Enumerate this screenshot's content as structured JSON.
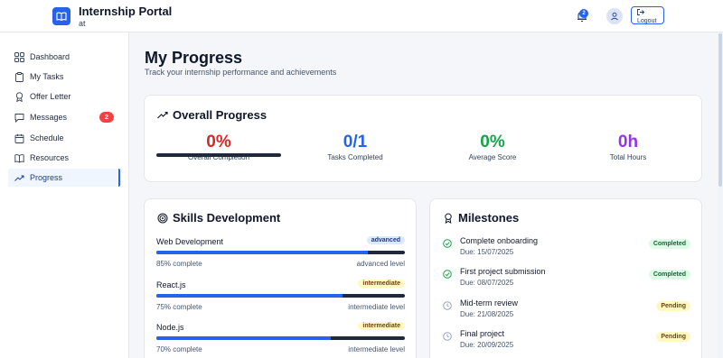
{
  "header": {
    "title": "Internship Portal",
    "subtitle": "at",
    "notification_count": "2",
    "logout_label": "Logout"
  },
  "sidebar": {
    "items": [
      {
        "label": "Dashboard",
        "icon": "grid-icon"
      },
      {
        "label": "My Tasks",
        "icon": "clipboard-icon"
      },
      {
        "label": "Offer Letter",
        "icon": "award-icon"
      },
      {
        "label": "Messages",
        "icon": "message-icon",
        "badge": "2"
      },
      {
        "label": "Schedule",
        "icon": "calendar-icon"
      },
      {
        "label": "Resources",
        "icon": "book-icon"
      },
      {
        "label": "Progress",
        "icon": "trending-up-icon",
        "active": true
      }
    ]
  },
  "page": {
    "title": "My Progress",
    "subtitle": "Track your internship performance and achievements"
  },
  "overall": {
    "title": "Overall Progress",
    "stats": [
      {
        "value": "0%",
        "label": "Overall Completion",
        "color": "#dc2626"
      },
      {
        "value": "0/1",
        "label": "Tasks Completed",
        "color": "#2563eb"
      },
      {
        "value": "0%",
        "label": "Average Score",
        "color": "#16a34a"
      },
      {
        "value": "0h",
        "label": "Total Hours",
        "color": "#9333ea"
      }
    ]
  },
  "skills": {
    "title": "Skills Development",
    "items": [
      {
        "name": "Web Development",
        "tag": "advanced",
        "percent": 85,
        "pct_text": "85% complete",
        "level_text": "advanced level"
      },
      {
        "name": "React.js",
        "tag": "intermediate",
        "percent": 75,
        "pct_text": "75% complete",
        "level_text": "intermediate level"
      },
      {
        "name": "Node.js",
        "tag": "intermediate",
        "percent": 70,
        "pct_text": "70% complete",
        "level_text": "intermediate level"
      }
    ]
  },
  "milestones": {
    "title": "Milestones",
    "items": [
      {
        "title": "Complete onboarding",
        "due": "Due: 15/07/2025",
        "status": "Completed"
      },
      {
        "title": "First project submission",
        "due": "Due: 08/07/2025",
        "status": "Completed"
      },
      {
        "title": "Mid-term review",
        "due": "Due: 21/08/2025",
        "status": "Pending"
      },
      {
        "title": "Final project",
        "due": "Due: 20/09/2025",
        "status": "Pending"
      }
    ]
  },
  "colors": {
    "accent": "#2563eb",
    "completed": "#16a34a",
    "pending": "#94a3b8"
  }
}
